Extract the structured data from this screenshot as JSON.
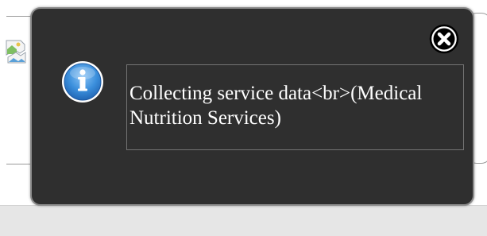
{
  "background": {
    "broken_image_icon": "broken-image-icon"
  },
  "dialog": {
    "icon": "info-icon",
    "close_icon": "close-icon",
    "message": "Collecting service data<br>(Medical Nutrition Services)",
    "colors": {
      "background": "#2f2f2f",
      "border": "#8c8c8c",
      "message_border": "#737373",
      "text": "#ffffff",
      "info_blue": "#2f7fd0"
    }
  }
}
